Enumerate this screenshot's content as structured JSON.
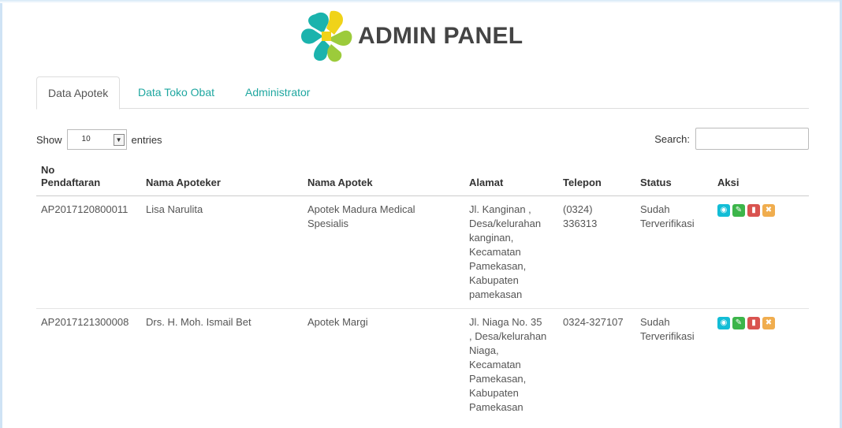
{
  "header": {
    "title": "ADMIN PANEL"
  },
  "tabs": [
    {
      "label": "Data Apotek",
      "active": true
    },
    {
      "label": "Data Toko Obat",
      "active": false
    },
    {
      "label": "Administrator",
      "active": false
    }
  ],
  "length": {
    "show_label": "Show",
    "value": "10",
    "entries_label": "entries"
  },
  "search": {
    "label": "Search:",
    "value": "",
    "placeholder": ""
  },
  "table": {
    "columns": {
      "no_line1": "No",
      "no_line2": "Pendaftaran",
      "nama_apoteker": "Nama Apoteker",
      "nama_apotek": "Nama Apotek",
      "alamat": "Alamat",
      "telepon": "Telepon",
      "status": "Status",
      "aksi": "Aksi"
    },
    "rows": [
      {
        "no": "AP2017120800011",
        "apoteker": "Lisa Narulita",
        "apotek_l1": "Apotek Madura Medical",
        "apotek_l2": "Spesialis",
        "alamat": [
          "Jl. Kanginan ,",
          "Desa/kelurahan",
          "kanginan,",
          "Kecamatan",
          "Pamekasan,",
          "Kabupaten",
          "pamekasan"
        ],
        "telepon_l1": "(0324)",
        "telepon_l2": "336313",
        "status_l1": "Sudah",
        "status_l2": "Terverifikasi"
      },
      {
        "no": "AP2017121300008",
        "apoteker": "Drs. H. Moh. Ismail Bet",
        "apotek_l1": "Apotek Margi",
        "apotek_l2": "",
        "alamat": [
          "Jl. Niaga No. 35",
          ", Desa/kelurahan",
          "Niaga,",
          "Kecamatan",
          "Pamekasan,",
          "Kabupaten",
          "Pamekasan"
        ],
        "telepon_l1": "0324-327107",
        "telepon_l2": "",
        "status_l1": "Sudah",
        "status_l2": "Terverifikasi"
      }
    ]
  },
  "icons": {
    "view": "eye-icon",
    "edit": "pencil-icon",
    "delete": "trash-icon",
    "reject": "x-icon"
  },
  "colors": {
    "accent": "#1fa7a0",
    "view": "#13bdd6",
    "edit": "#3cb54a",
    "delete": "#d9534f",
    "reject": "#f0ad4e",
    "logo_teal": "#1bb3ad",
    "logo_green": "#9ccb3b",
    "logo_yellow": "#f0d319"
  }
}
